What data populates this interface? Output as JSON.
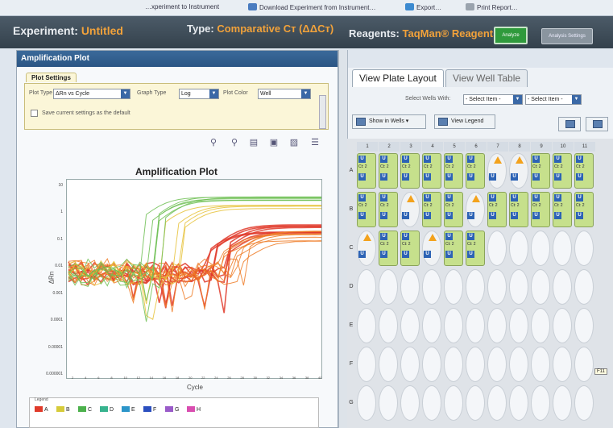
{
  "toolbar": {
    "items": [
      {
        "label": "…xperiment to Instrument",
        "icon": "send-icon"
      },
      {
        "label": "Download Experiment from Instrument…",
        "icon": "download-icon"
      },
      {
        "label": "Export…",
        "icon": "export-icon"
      },
      {
        "label": "Print Report…",
        "icon": "printer-icon"
      }
    ]
  },
  "experiment": {
    "label": "Experiment:",
    "name": "Untitled",
    "type_label": "Type:",
    "type_value": "Comparative Cт (ΔΔCт)",
    "reagents_label": "Reagents:",
    "reagents_value": "TaqMan® Reagents",
    "analyze_button": "Analyze",
    "analysis_settings_button": "Analysis Settings"
  },
  "amplification_panel": {
    "title": "Amplification Plot",
    "settings_tab": "Plot Settings",
    "plot_type_label": "Plot Type",
    "plot_type_value": "ΔRn vs Cycle",
    "graph_type_label": "Graph Type",
    "graph_type_value": "Log",
    "plot_color_label": "Plot Color",
    "plot_color_value": "Well",
    "save_default_label": "Save current settings as the default",
    "save_default_checked": false
  },
  "chart_data": {
    "type": "line",
    "title": "Amplification Plot",
    "xlabel": "Cycle",
    "ylabel": "ΔRn",
    "yscale": "log",
    "ylim": [
      1e-06,
      10
    ],
    "xlim": [
      1,
      40
    ],
    "x_ticks": [
      "2",
      "4",
      "6",
      "8",
      "10",
      "12",
      "14",
      "16",
      "18",
      "20",
      "22",
      "24",
      "26",
      "28",
      "30",
      "32",
      "34",
      "36",
      "38",
      "40"
    ],
    "y_ticks": [
      "10",
      "1",
      "0.1",
      "0.01",
      "0.001",
      "0.0001",
      "0.00001",
      "0.000001"
    ],
    "grid": false,
    "series_groups": [
      {
        "color": "#e03a2a",
        "count": 8,
        "plateau": 0.3,
        "ct": 27
      },
      {
        "color": "#ef7b26",
        "count": 8,
        "plateau": 0.15,
        "ct": 29
      },
      {
        "color": "#e6c23a",
        "count": 4,
        "plateau": 1.5,
        "ct": 20
      },
      {
        "color": "#6fbf54",
        "count": 6,
        "plateau": 3,
        "ct": 17
      }
    ]
  },
  "legend": {
    "title": "Legend",
    "items": [
      {
        "label": "A",
        "color": "#e03a2a"
      },
      {
        "label": "B",
        "color": "#d6cb3a"
      },
      {
        "label": "C",
        "color": "#4cb14c"
      },
      {
        "label": "D",
        "color": "#37b38e"
      },
      {
        "label": "E",
        "color": "#2c95c9"
      },
      {
        "label": "F",
        "color": "#2b4fbf"
      },
      {
        "label": "G",
        "color": "#9a5bc9"
      },
      {
        "label": "H",
        "color": "#d94db0"
      }
    ]
  },
  "plate_panel": {
    "tabs": [
      "View Plate Layout",
      "View Well Table"
    ],
    "select_wells_label": "Select Wells With:",
    "select1_value": "- Select Item -",
    "select2_value": "- Select Item -",
    "show_in_wells_button": "Show in Wells ▾",
    "view_legend_button": "View Legend",
    "columns": [
      "1",
      "2",
      "3",
      "4",
      "5",
      "6",
      "7",
      "8",
      "9",
      "10",
      "11"
    ],
    "rows": [
      "A",
      "B",
      "C",
      "D",
      "E",
      "F",
      "G"
    ],
    "well_text": "Ct: 2",
    "tooltip": "F11"
  }
}
